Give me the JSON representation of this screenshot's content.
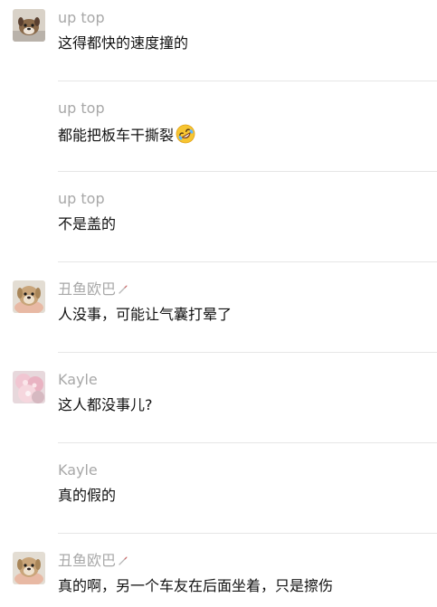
{
  "messages": [
    {
      "sender": "up top",
      "avatar": "dog-avatar",
      "text": "这得都快的速度撞的",
      "emoji": ""
    },
    {
      "sender": "up top",
      "avatar": "",
      "text": "都能把板车干撕裂",
      "emoji": "rolling-laughing-emoji"
    },
    {
      "sender": "up top",
      "avatar": "",
      "text": "不是盖的",
      "emoji": ""
    },
    {
      "sender": "丑鱼欧巴",
      "avatar": "puppy-avatar",
      "text": "人没事，可能让气囊打晕了",
      "emoji": ""
    },
    {
      "sender": "Kayle",
      "avatar": "flower-avatar",
      "text": "这人都没事儿?",
      "emoji": ""
    },
    {
      "sender": "Kayle",
      "avatar": "",
      "text": "真的假的",
      "emoji": ""
    },
    {
      "sender": "丑鱼欧巴",
      "avatar": "puppy-avatar",
      "text": "真的啊，另一个车友在后面坐着，只是擦伤",
      "emoji": ""
    }
  ],
  "colors": {
    "sender_name": "#a8a8a8",
    "message_text": "#111111",
    "divider": "#e6e6e6",
    "background": "#ffffff"
  }
}
